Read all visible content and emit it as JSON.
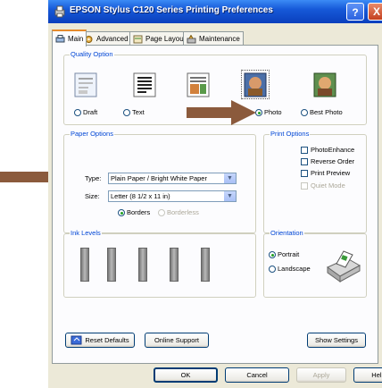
{
  "window": {
    "title": "EPSON Stylus C120 Series Printing Preferences",
    "help_label": "?",
    "close_label": "X"
  },
  "tabs": [
    {
      "label": "Main",
      "icon": "printer-icon",
      "active": true
    },
    {
      "label": "Advanced",
      "icon": "gear-icon",
      "active": false
    },
    {
      "label": "Page Layout",
      "icon": "page-layout-icon",
      "active": false
    },
    {
      "label": "Maintenance",
      "icon": "maintenance-icon",
      "active": false
    }
  ],
  "quality": {
    "group_label": "Quality Option",
    "options": [
      {
        "label": "Draft",
        "icon": "draft-icon",
        "selected": false
      },
      {
        "label": "Text",
        "icon": "text-icon",
        "selected": false
      },
      {
        "label": "Photo",
        "icon": "photo-icon",
        "selected": true
      },
      {
        "label": "Best Photo",
        "icon": "best-photo-icon",
        "selected": false
      }
    ]
  },
  "paper": {
    "group_label": "Paper Options",
    "type_label": "Type:",
    "type_value": "Plain Paper / Bright White Paper",
    "size_label": "Size:",
    "size_value": "Letter (8 1/2 x 11 in)",
    "borders_label": "Borders",
    "borderless_label": "Borderless"
  },
  "print_options": {
    "group_label": "Print Options",
    "items": [
      {
        "label": "PhotoEnhance",
        "enabled": true
      },
      {
        "label": "Reverse Order",
        "enabled": true
      },
      {
        "label": "Print Preview",
        "enabled": true
      },
      {
        "label": "Quiet Mode",
        "enabled": false
      }
    ]
  },
  "ink": {
    "group_label": "Ink Levels",
    "cartridge_count": 5
  },
  "orientation": {
    "group_label": "Orientation",
    "portrait_label": "Portrait",
    "landscape_label": "Landscape",
    "selected": "Portrait"
  },
  "footer": {
    "reset_label": "Reset Defaults",
    "online_support_label": "Online Support",
    "show_settings_label": "Show Settings"
  },
  "dialog_buttons": {
    "ok": "OK",
    "cancel": "Cancel",
    "apply": "Apply",
    "help": "Help"
  },
  "colors": {
    "titlebar": "#0a3fbd",
    "arrow": "#8b5a3c",
    "group_label": "#0046d5",
    "active_tab_accent": "#e68b2c"
  }
}
